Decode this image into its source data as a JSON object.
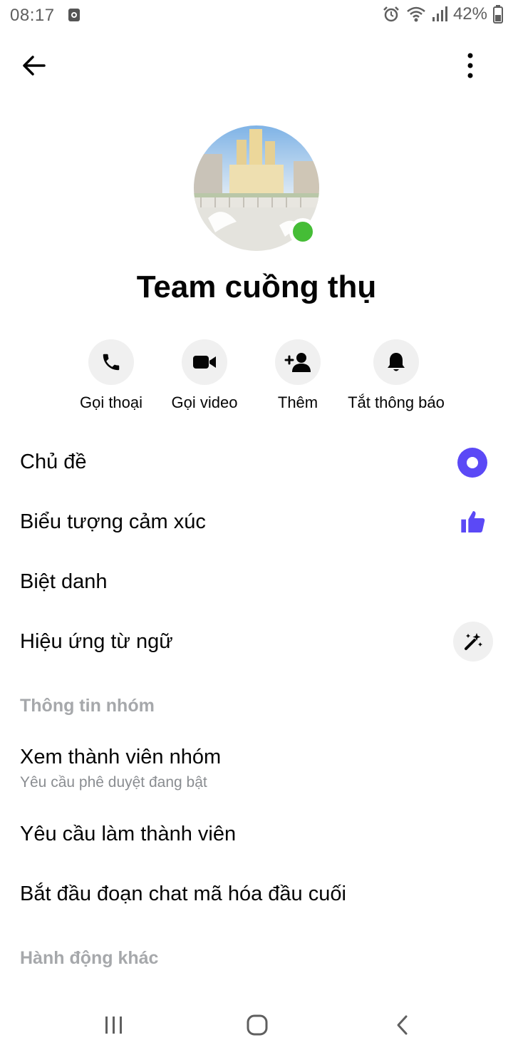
{
  "status_bar": {
    "time": "08:17",
    "battery": "42%"
  },
  "header": {
    "back_icon": "arrow-left-icon",
    "more_icon": "vertical-dots-icon"
  },
  "group": {
    "name": "Team cuồng thụ",
    "online": true,
    "online_color": "#45bd36"
  },
  "actions": [
    {
      "label": "Gọi thoại",
      "icon": "phone-icon"
    },
    {
      "label": "Gọi video",
      "icon": "video-camera-icon"
    },
    {
      "label": "Thêm",
      "icon": "add-person-icon"
    },
    {
      "label": "Tắt thông báo",
      "icon": "bell-icon"
    }
  ],
  "customize": {
    "theme": "Chủ đề",
    "emoji": "Biểu tượng cảm xúc",
    "nicknames": "Biệt danh",
    "word_effects": "Hiệu ứng từ ngữ",
    "accent_color": "#5b49f6"
  },
  "group_info": {
    "header": "Thông tin nhóm",
    "members": "Xem thành viên nhóm",
    "members_sub": "Yêu cầu phê duyệt đang bật",
    "requests": "Yêu cầu làm thành viên",
    "e2ee": "Bắt đầu đoạn chat mã hóa đầu cuối"
  },
  "other_actions": {
    "header": "Hành động khác"
  },
  "nav_bar": {
    "recents_icon": "recents-icon",
    "home_icon": "home-icon",
    "back_icon": "nav-back-icon"
  }
}
